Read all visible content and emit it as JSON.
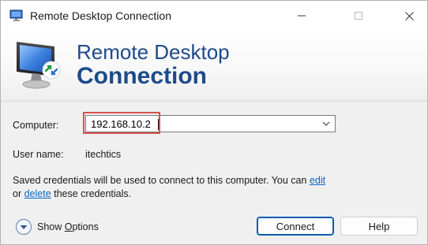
{
  "window": {
    "title": "Remote Desktop Connection"
  },
  "banner": {
    "line1": "Remote Desktop",
    "line2": "Connection"
  },
  "form": {
    "computer_label": "Computer:",
    "computer_value": "192.168.10.2",
    "user_label": "User name:",
    "user_value": "itechtics"
  },
  "info": {
    "text_a": "Saved credentials will be used to connect to this computer.  You can ",
    "edit_link": "edit",
    "text_b": " or ",
    "delete_link": "delete",
    "text_c": " these credentials."
  },
  "footer": {
    "show_options_prefix": "Show ",
    "show_options_underlined": "O",
    "show_options_suffix": "ptions",
    "connect_label": "Connect",
    "help_label": "Help"
  },
  "colors": {
    "banner_text": "#1c4a8c",
    "highlight_border": "#d9504f",
    "link": "#0a66c2",
    "default_button_border": "#0b5cad"
  },
  "icons": {
    "titlebar": "remote-desktop-icon",
    "banner": "remote-desktop-monitor-icon",
    "combo": "chevron-down-icon",
    "options": "expand-down-icon",
    "minimize": "minimize-icon",
    "maximize": "maximize-icon",
    "close": "close-icon"
  }
}
